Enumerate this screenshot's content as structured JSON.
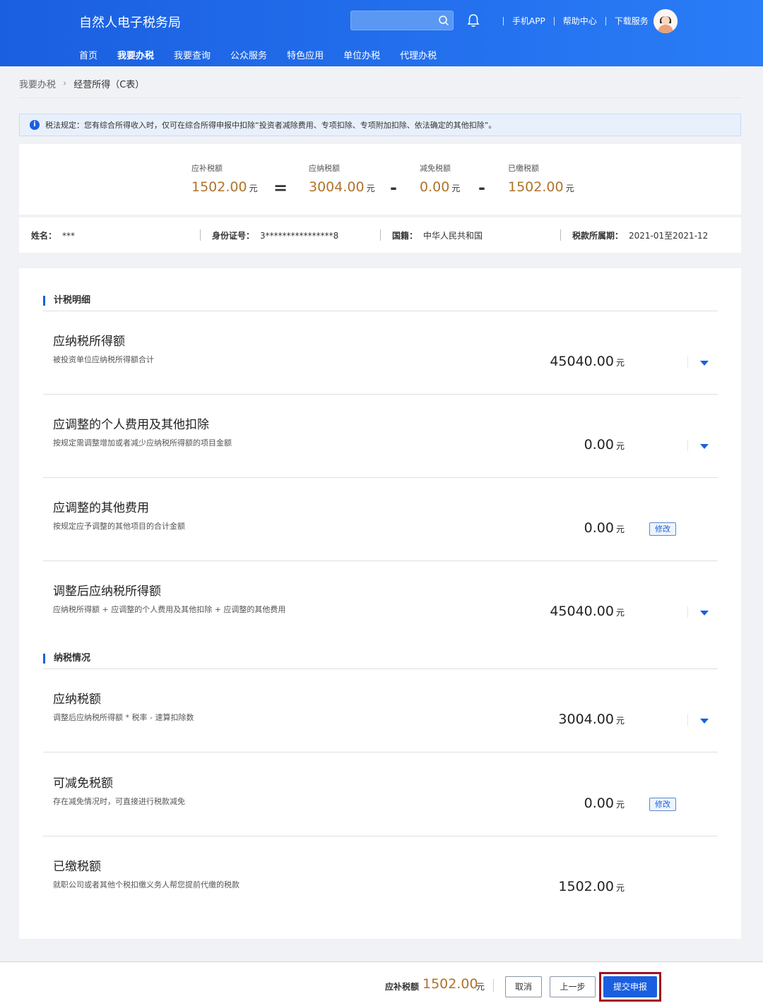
{
  "header": {
    "site_title": "自然人电子税务局",
    "links": [
      "手机APP",
      "帮助中心",
      "下载服务"
    ],
    "nav": [
      "首页",
      "我要办税",
      "我要查询",
      "公众服务",
      "特色应用",
      "单位办税",
      "代理办税"
    ],
    "active_nav": "我要办税"
  },
  "breadcrumb": {
    "root": "我要办税",
    "current": "经营所得（C表）"
  },
  "notice": "税法规定：您有综合所得收入时，仅可在综合所得申报中扣除“投资者减除费用、专项扣除、专项附加扣除、依法确定的其他扣除”。",
  "summary": {
    "unit": "元",
    "items": [
      {
        "label": "应补税额",
        "value": "1502.00"
      },
      {
        "label": "应纳税额",
        "value": "3004.00"
      },
      {
        "label": "减免税额",
        "value": "0.00"
      },
      {
        "label": "已缴税额",
        "value": "1502.00"
      }
    ],
    "operators": [
      "=",
      "-",
      "-"
    ]
  },
  "taxpayer": {
    "name_label": "姓名：",
    "name": "***",
    "id_label": "身份证号：",
    "id": "3****************8",
    "country_label": "国籍：",
    "country": "中华人民共和国",
    "period_label": "税款所属期：",
    "period": "2021-01至2021-12"
  },
  "sections": {
    "calc_title": "计税明细",
    "pay_title": "纳税情况"
  },
  "rows": [
    {
      "title": "应纳税所得额",
      "desc": "被投资单位应纳税所得额合计",
      "value": "45040.00",
      "action": "expand"
    },
    {
      "title": "应调整的个人费用及其他扣除",
      "desc": "按规定需调整增加或者减少应纳税所得额的项目金额",
      "value": "0.00",
      "action": "expand"
    },
    {
      "title": "应调整的其他费用",
      "desc": "按规定应予调整的其他项目的合计金额",
      "value": "0.00",
      "action": "edit"
    },
    {
      "title": "调整后应纳税所得额",
      "desc": "应纳税所得额 + 应调整的个人费用及其他扣除 + 应调整的其他费用",
      "value": "45040.00",
      "action": "expand"
    },
    {
      "title": "应纳税额",
      "desc": "调整后应纳税所得额 * 税率 - 速算扣除数",
      "value": "3004.00",
      "action": "expand"
    },
    {
      "title": "可减免税额",
      "desc": "存在减免情况时，可直接进行税款减免",
      "value": "0.00",
      "action": "edit"
    },
    {
      "title": "已缴税额",
      "desc": "就职公司或者其他个税扣缴义务人帮您提前代缴的税款",
      "value": "1502.00",
      "action": "none"
    }
  ],
  "unit": "元",
  "edit_label": "修改",
  "footer": {
    "label": "应补税额",
    "value": "1502.00",
    "unit": "元",
    "cancel": "取消",
    "prev": "上一步",
    "submit": "提交申报"
  },
  "colors": {
    "primary": "#1a5fe0",
    "amount": "#b0732a",
    "highlight": "#a0121f"
  }
}
